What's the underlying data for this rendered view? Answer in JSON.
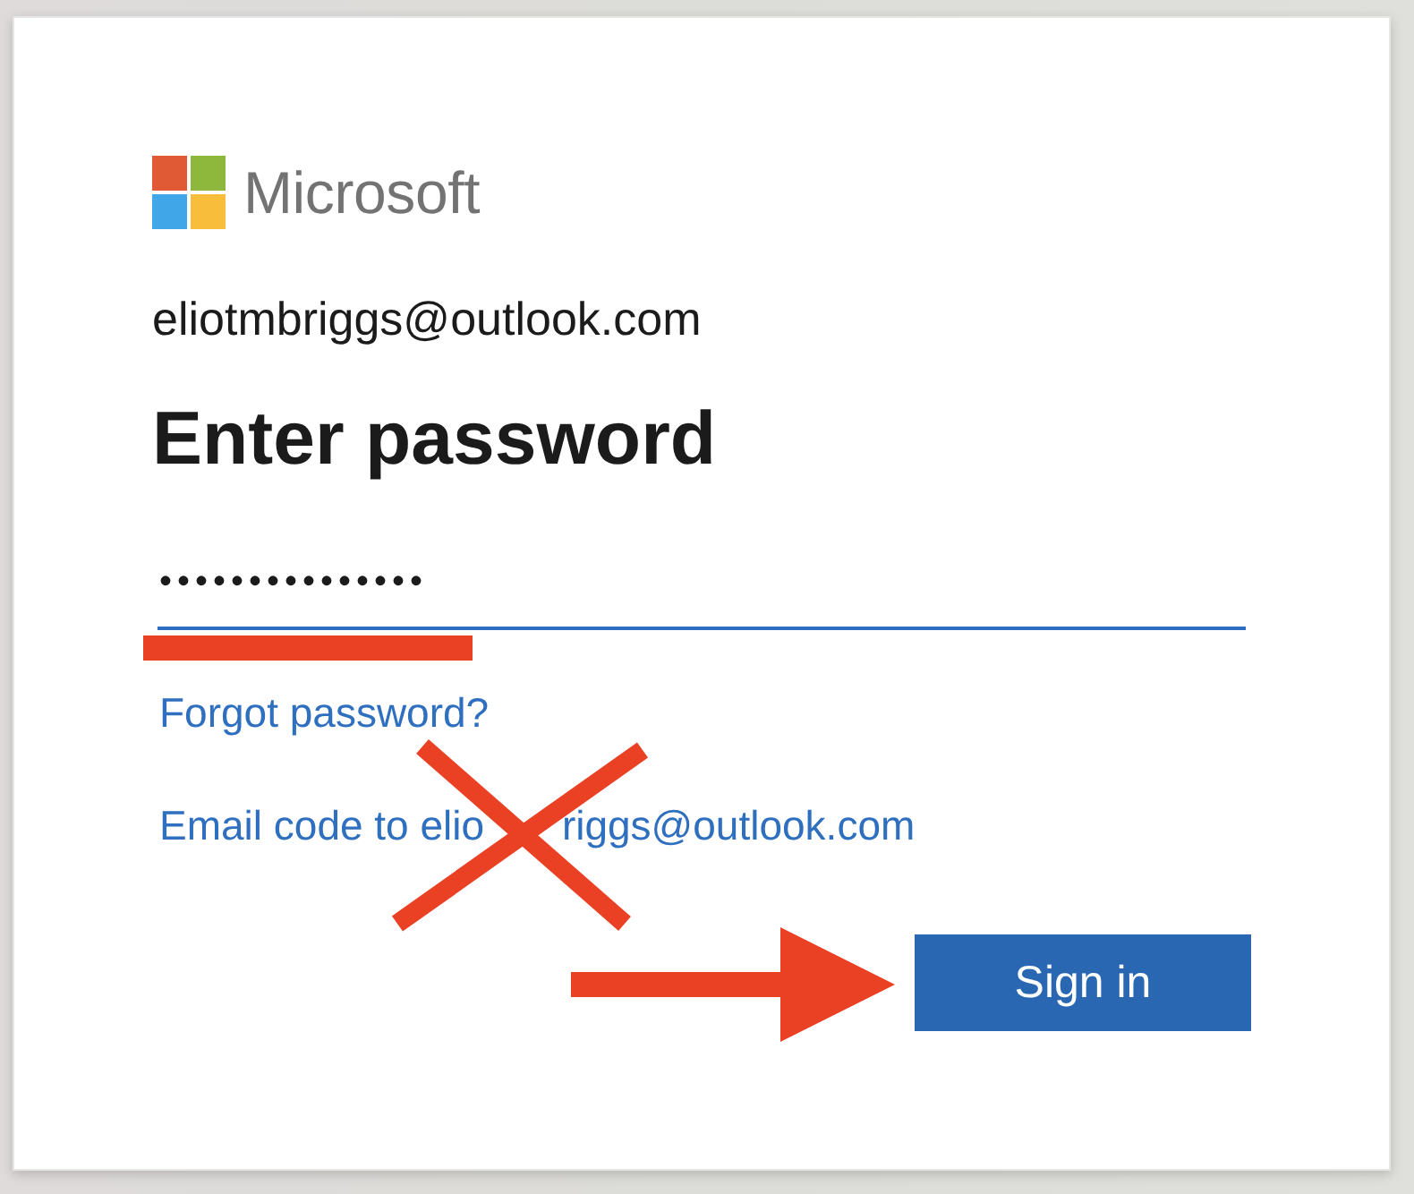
{
  "brand": {
    "name": "Microsoft"
  },
  "account": {
    "email": "eliotmbriggs@outlook.com"
  },
  "heading": "Enter password",
  "password_field": {
    "value": "•••••••••••••••"
  },
  "links": [
    {
      "visible_parts": [
        "Forgot password?"
      ]
    },
    {
      "visible_parts": [
        "Email code to elio",
        "riggs@outlook.com"
      ]
    }
  ],
  "buttons": [
    {
      "label": "Sign in",
      "kind": "primary"
    }
  ],
  "annotations": [
    {
      "kind": "underline"
    },
    {
      "kind": "cross"
    },
    {
      "kind": "arrow"
    }
  ]
}
